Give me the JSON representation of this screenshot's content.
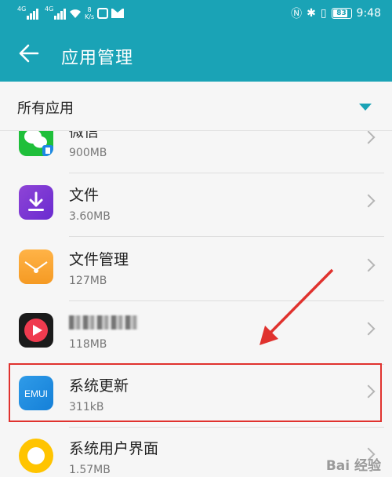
{
  "status_bar": {
    "signal1_label": "4G",
    "signal2_label": "4G",
    "net_speed_value": "8",
    "net_speed_unit": "K/s",
    "battery": "83",
    "time": "9:48"
  },
  "app_bar": {
    "title": "应用管理",
    "back_icon": "arrow-left-icon"
  },
  "filter": {
    "label": "所有应用",
    "dropdown_icon": "triangle-down-icon"
  },
  "apps": [
    {
      "name": "微信",
      "size": "900MB",
      "icon": "wechat-icon"
    },
    {
      "name": "文件",
      "size": "3.60MB",
      "icon": "download-file-icon"
    },
    {
      "name": "文件管理",
      "size": "127MB",
      "icon": "folder-icon"
    },
    {
      "name": "",
      "size": "118MB",
      "icon": "play-icon"
    },
    {
      "name": "系统更新",
      "size": "311kB",
      "icon": "emui-icon",
      "icon_text": "EMUI"
    },
    {
      "name": "系统用户界面",
      "size": "1.57MB",
      "icon": "ring-icon"
    }
  ],
  "colors": {
    "accent": "#1aa3b6",
    "highlight": "#e0322e"
  },
  "watermark": "Bai 经验"
}
